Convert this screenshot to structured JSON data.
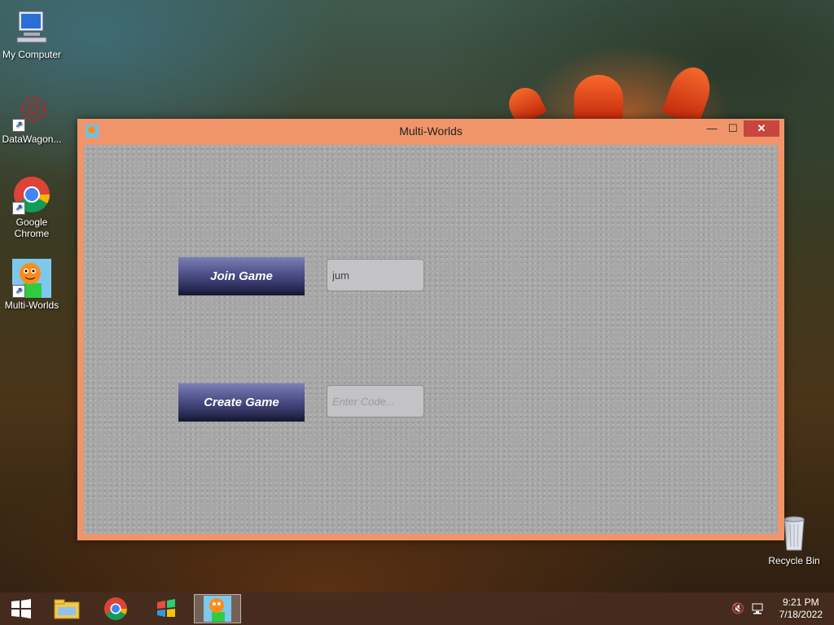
{
  "desktop": {
    "icons": [
      {
        "label": "My Computer"
      },
      {
        "label": "DataWagon..."
      },
      {
        "label": "Google Chrome"
      },
      {
        "label": "Multi-Worlds"
      },
      {
        "label": "Recycle Bin"
      }
    ]
  },
  "window": {
    "title": "Multi-Worlds",
    "controls": {
      "minimize": "—",
      "maximize": "☐",
      "close": "✕"
    },
    "join_button": "Join Game",
    "join_input_value": "jum",
    "create_button": "Create Game",
    "create_input_placeholder": "Enter Code..."
  },
  "taskbar": {
    "icons": [
      "windows-start-icon",
      "file-explorer-icon",
      "chrome-icon",
      "windows-media-icon",
      "multi-worlds-app-icon"
    ],
    "tray_icons": [
      "volume-muted-icon",
      "network-icon"
    ],
    "time": "9:21 PM",
    "date": "7/18/2022"
  }
}
